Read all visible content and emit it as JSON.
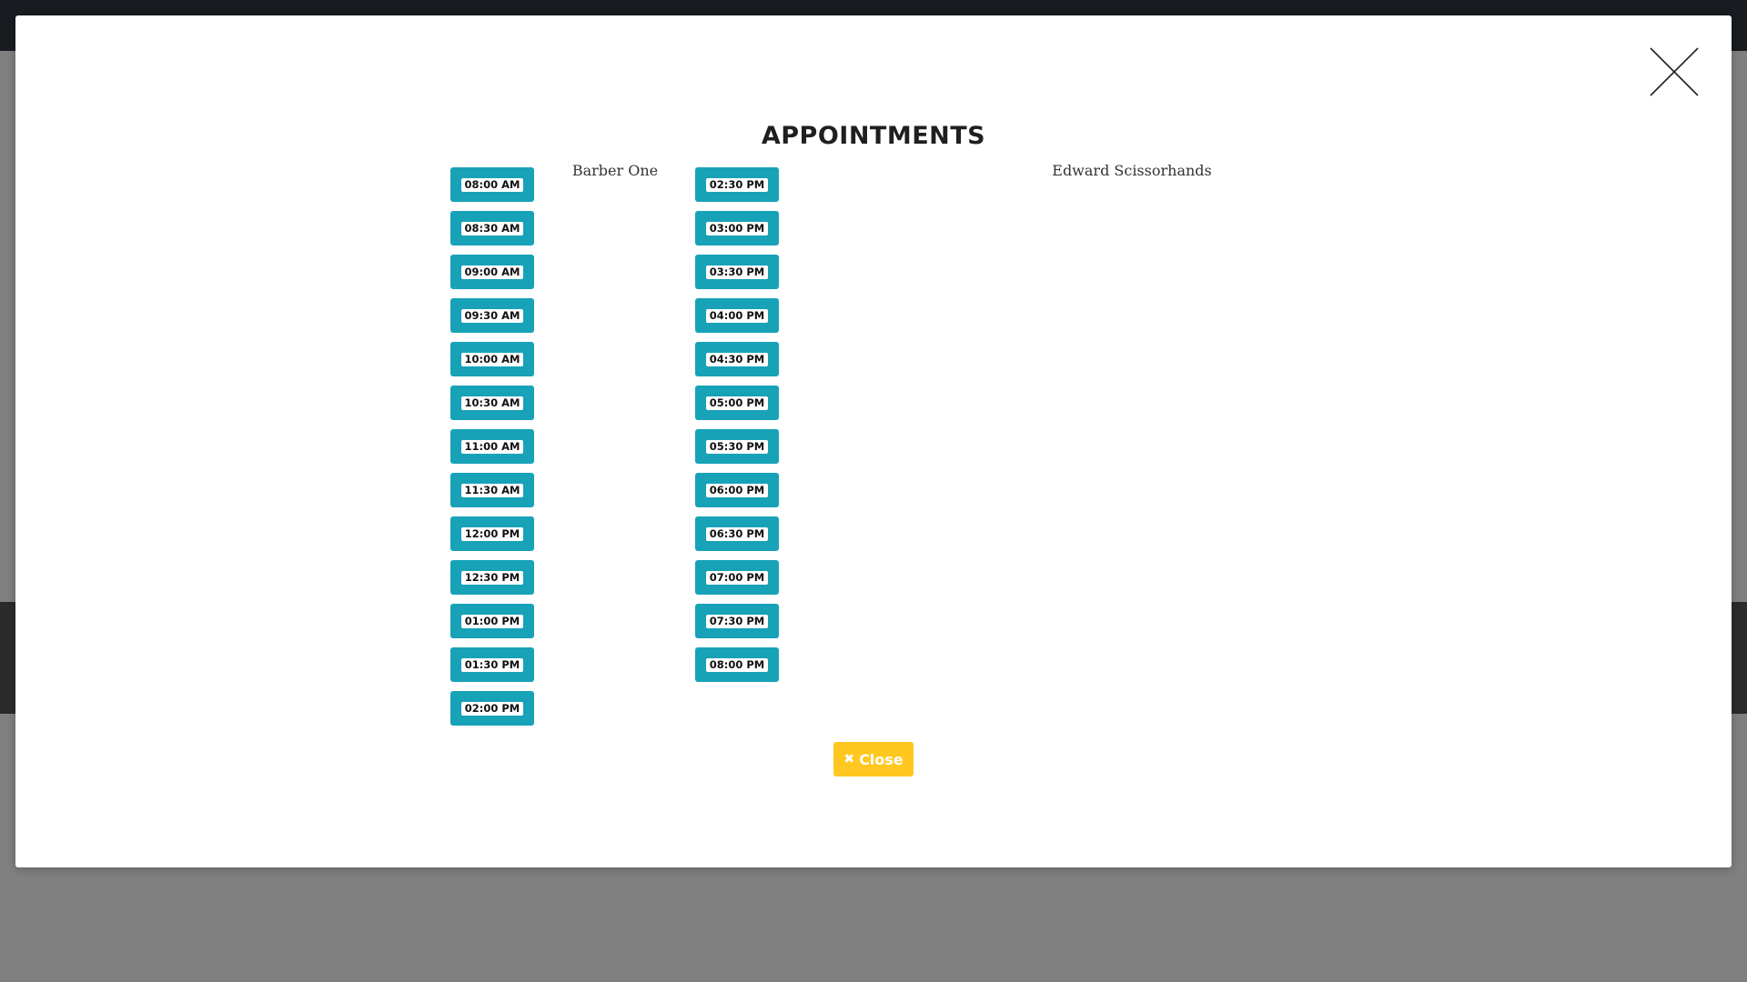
{
  "modal": {
    "title": "APPOINTMENTS",
    "close_label": "Close",
    "close_glyph": "✖"
  },
  "barbers": [
    {
      "name": "Barber One"
    },
    {
      "name": "Edward Scissorhands"
    }
  ],
  "slots": {
    "column_a": [
      "08:00 AM",
      "08:30 AM",
      "09:00 AM",
      "09:30 AM",
      "10:00 AM",
      "10:30 AM",
      "11:00 AM",
      "11:30 AM",
      "12:00 PM",
      "12:30 PM",
      "01:00 PM",
      "01:30 PM",
      "02:00 PM"
    ],
    "column_b": [
      "02:30 PM",
      "03:00 PM",
      "03:30 PM",
      "04:00 PM",
      "04:30 PM",
      "05:00 PM",
      "05:30 PM",
      "06:00 PM",
      "06:30 PM",
      "07:00 PM",
      "07:30 PM",
      "08:00 PM"
    ]
  },
  "colors": {
    "slot_button": "#17a2b8",
    "close_button": "#ffc720",
    "overlay": "#808080"
  }
}
